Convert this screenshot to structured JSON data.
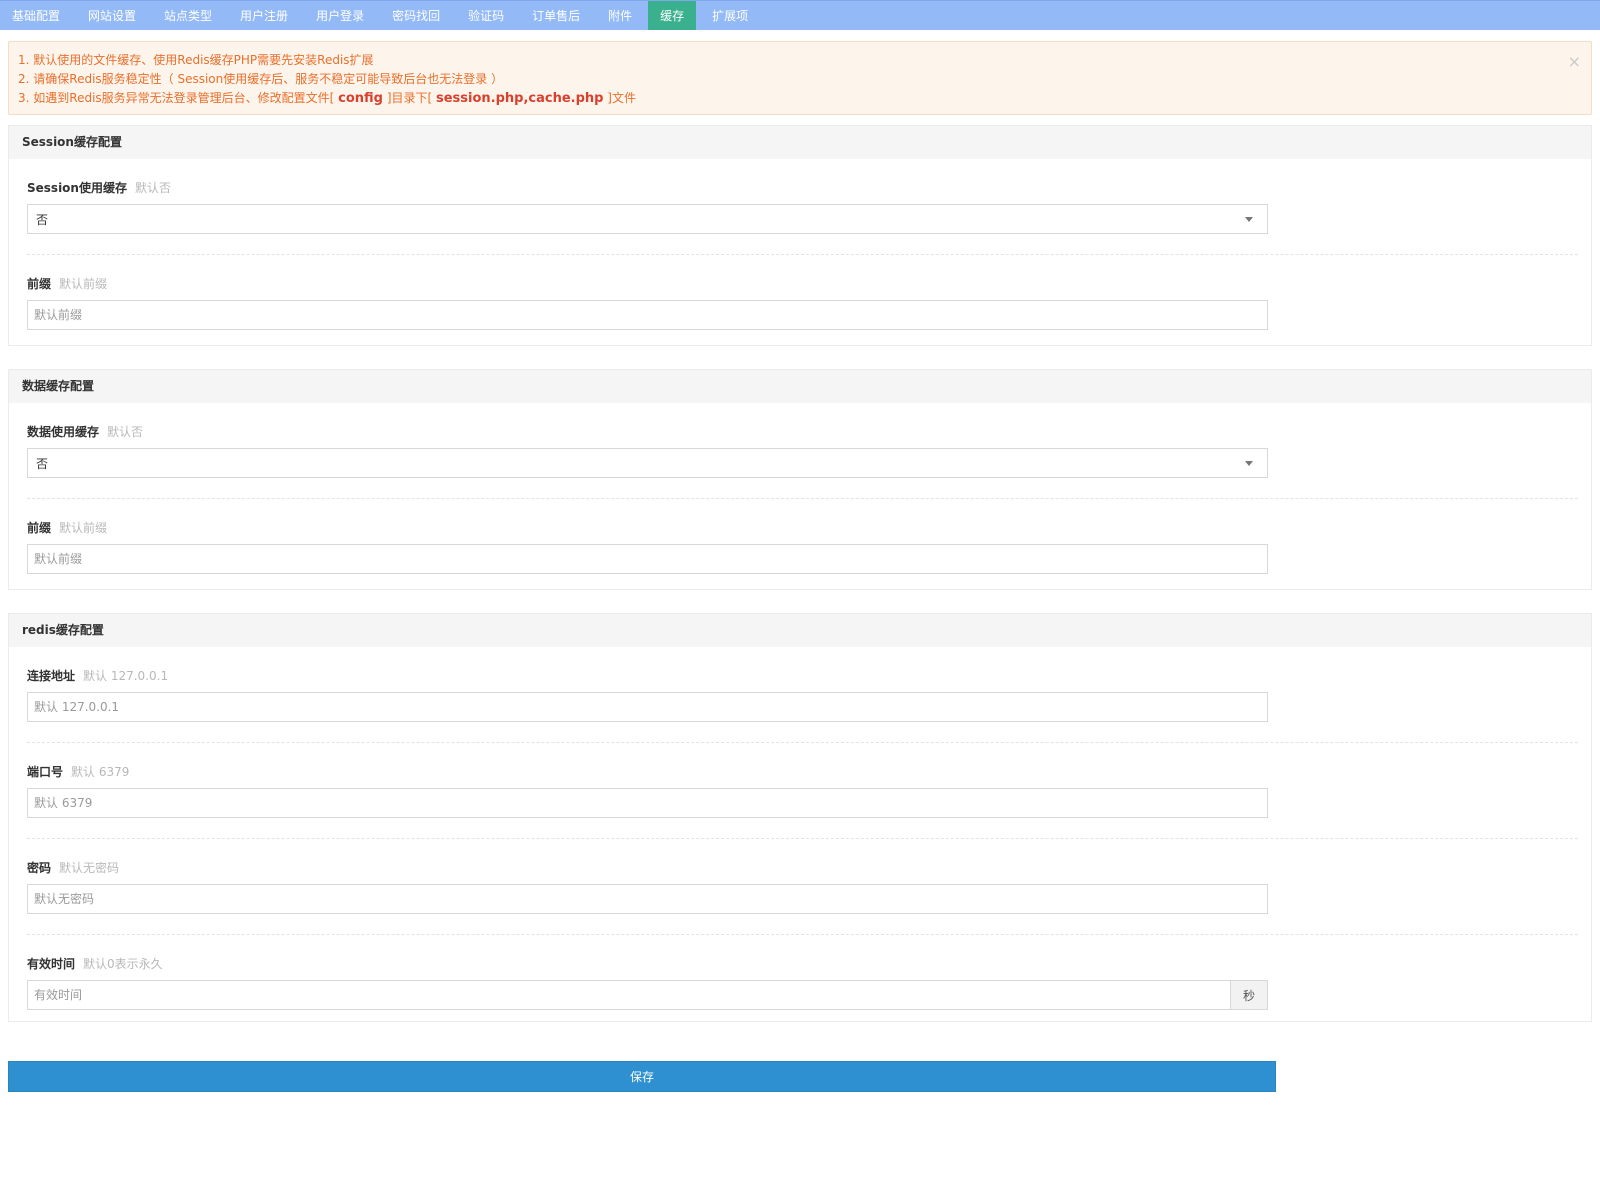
{
  "tabs": [
    {
      "label": "基础配置"
    },
    {
      "label": "网站设置"
    },
    {
      "label": "站点类型"
    },
    {
      "label": "用户注册"
    },
    {
      "label": "用户登录"
    },
    {
      "label": "密码找回"
    },
    {
      "label": "验证码"
    },
    {
      "label": "订单售后"
    },
    {
      "label": "附件"
    },
    {
      "label": "缓存",
      "active": true
    },
    {
      "label": "扩展项"
    }
  ],
  "alert": {
    "line1": "1. 默认使用的文件缓存、使用Redis缓存PHP需要先安装Redis扩展",
    "line2": "2. 请确保Redis服务稳定性（ Session使用缓存后、服务不稳定可能导致后台也无法登录 ）",
    "line3_prefix": "3. 如遇到Redis服务异常无法登录管理后台、修改配置文件[ ",
    "line3_config": "config",
    "line3_mid": " ]目录下[ ",
    "line3_files": "session.php,cache.php",
    "line3_suffix": " ]文件",
    "close": "×"
  },
  "session_panel": {
    "title": "Session缓存配置",
    "use_cache": {
      "label": "Session使用缓存",
      "hint": "默认否",
      "value": "否"
    },
    "prefix": {
      "label": "前缀",
      "hint": "默认前缀",
      "placeholder": "默认前缀"
    }
  },
  "data_panel": {
    "title": "数据缓存配置",
    "use_cache": {
      "label": "数据使用缓存",
      "hint": "默认否",
      "value": "否"
    },
    "prefix": {
      "label": "前缀",
      "hint": "默认前缀",
      "placeholder": "默认前缀"
    }
  },
  "redis_panel": {
    "title": "redis缓存配置",
    "host": {
      "label": "连接地址",
      "hint": "默认 127.0.0.1",
      "placeholder": "默认 127.0.0.1"
    },
    "port": {
      "label": "端口号",
      "hint": "默认 6379",
      "placeholder": "默认 6379"
    },
    "password": {
      "label": "密码",
      "hint": "默认无密码",
      "placeholder": "默认无密码"
    },
    "expire": {
      "label": "有效时间",
      "hint": "默认0表示永久",
      "placeholder": "有效时间",
      "unit": "秒"
    }
  },
  "save_button": {
    "label": "保存"
  },
  "colors": {
    "tabbar": "#93b9f7",
    "tab_active": "#3bb08f",
    "alert_text": "#e96f2c",
    "alert_strong": "#d9402d",
    "save_button": "#2e90d0"
  }
}
